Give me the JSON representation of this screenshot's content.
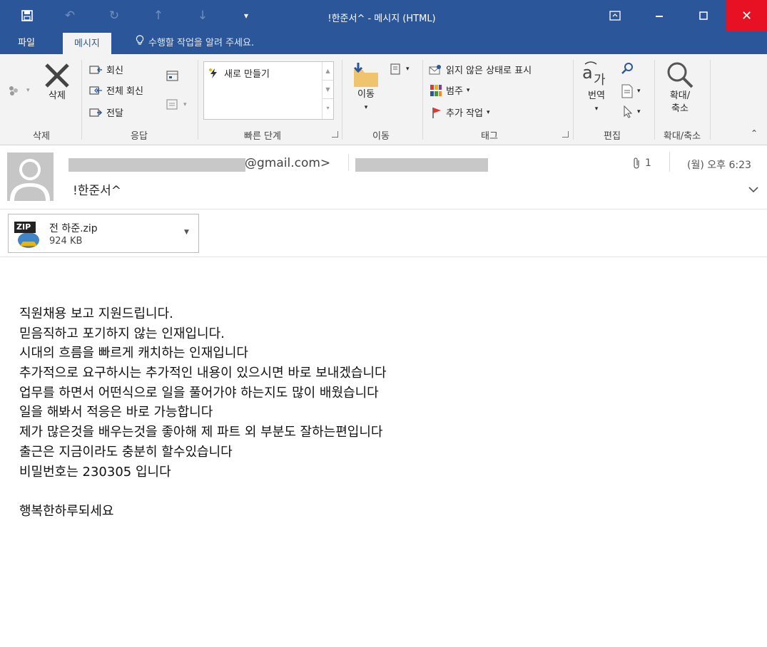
{
  "window": {
    "title": "!한준서^ - 메시지 (HTML)"
  },
  "tabs": {
    "file": "파일",
    "message": "메시지",
    "tell_me": "수행할 작업을 알려 주세요."
  },
  "ribbon": {
    "delete_group": {
      "delete": "삭제",
      "label": "삭제"
    },
    "respond_group": {
      "reply": "회신",
      "reply_all": "전체 회신",
      "forward": "전달",
      "label": "응답"
    },
    "quick_steps_group": {
      "new": "새로 만들기",
      "label": "빠른 단계"
    },
    "move_group": {
      "move": "이동",
      "label": "이동"
    },
    "tags_group": {
      "mark_unread": "읽지 않은 상태로 표시",
      "categorize": "범주",
      "follow_up": "추가 작업",
      "label": "태그"
    },
    "editing_group": {
      "translate": "번역",
      "label": "편집"
    },
    "zoom_group": {
      "zoom_line1": "확대/",
      "zoom_line2": "축소",
      "label": "확대/축소"
    }
  },
  "header": {
    "sender_suffix": "@gmail.com>",
    "subject": "!한준서^",
    "attachment_count": "1",
    "datetime": "(월) 오후 6:23"
  },
  "attachment": {
    "badge": "ZIP",
    "name": "전 하준.zip",
    "size": "924 KB"
  },
  "body": {
    "lines": [
      "직원채용 보고 지원드립니다.",
      "믿음직하고 포기하지 않는 인재입니다.",
      "시대의 흐름을 빠르게 캐치하는 인재입니다",
      "추가적으로 요구하시는 추가적인 내용이 있으시면 바로 보내겠습니다",
      "업무를 하면서 어떤식으로 일을 풀어가야 하는지도 많이 배웠습니다",
      "일을 해봐서 적응은 바로 가능합니다",
      "제가 많은것을 배우는것을 좋아해 제 파트 외 부분도 잘하는편입니다",
      "출근은 지금이라도 충분히 할수있습니다",
      "비밀번호는 230305 입니다",
      "",
      "행복한하루되세요"
    ]
  }
}
